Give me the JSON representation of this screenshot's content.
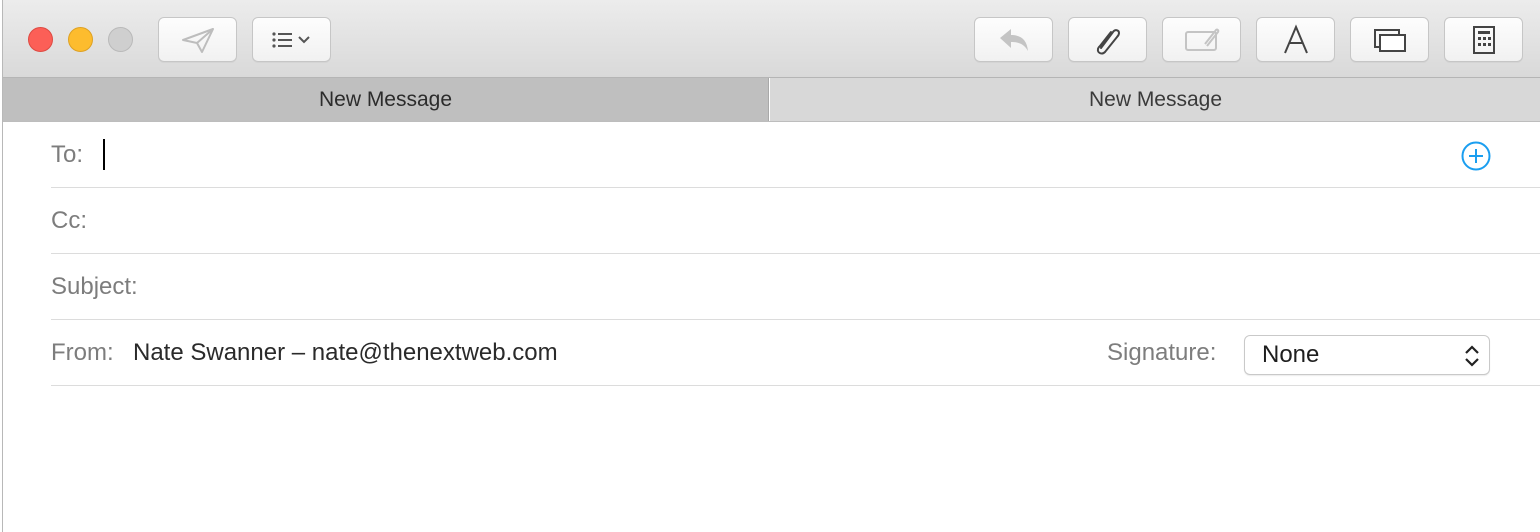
{
  "window": {
    "tabs": [
      {
        "label": "New Message",
        "active": true
      },
      {
        "label": "New Message",
        "active": false
      }
    ]
  },
  "toolbar": {
    "buttons": [
      {
        "name": "send-button",
        "icon": "paper-plane-icon"
      },
      {
        "name": "header-fields-button",
        "icon": "list-chevron-icon"
      },
      {
        "name": "reply-button",
        "icon": "reply-arrow-icon"
      },
      {
        "name": "attach-button",
        "icon": "paperclip-icon"
      },
      {
        "name": "markup-button",
        "icon": "markup-icon"
      },
      {
        "name": "fonts-button",
        "icon": "font-a-icon"
      },
      {
        "name": "photo-browser-button",
        "icon": "photo-browser-icon"
      },
      {
        "name": "stationery-button",
        "icon": "stationery-icon"
      }
    ]
  },
  "compose": {
    "to": {
      "label": "To:",
      "value": ""
    },
    "cc": {
      "label": "Cc:",
      "value": ""
    },
    "subject": {
      "label": "Subject:",
      "value": ""
    },
    "from": {
      "label": "From:",
      "value": "Nate Swanner – nate@thenextweb.com"
    },
    "signature": {
      "label": "Signature:",
      "selected": "None"
    },
    "body": ""
  },
  "colors": {
    "close": "#fc5f57",
    "minimize": "#fdbc2e",
    "zoom": "#cfcfcf",
    "accent": "#1a9ef0"
  }
}
